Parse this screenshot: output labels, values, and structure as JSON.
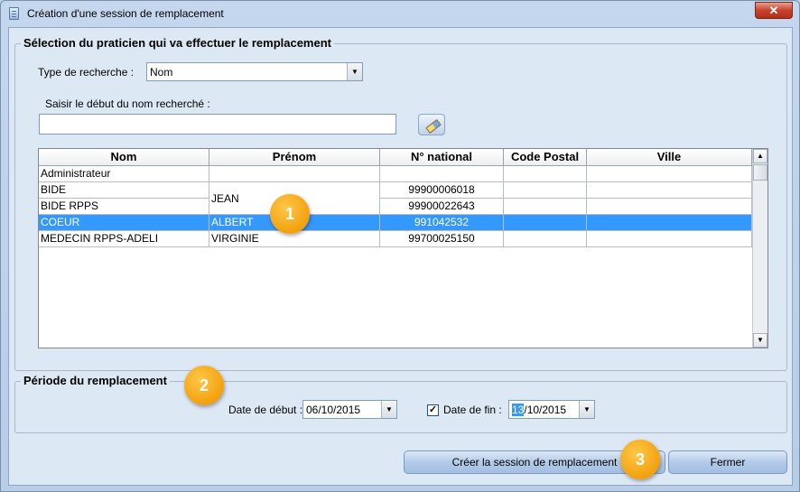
{
  "window": {
    "title": "Création d'une session de remplacement",
    "close_label": "✕"
  },
  "selection": {
    "group_title": "Sélection du praticien qui va effectuer le remplacement",
    "search_type_label": "Type de recherche :",
    "search_type_value": "Nom",
    "name_prompt": "Saisir le début du nom recherché :",
    "name_value": ""
  },
  "table": {
    "columns": [
      "Nom",
      "Prénom",
      "N° national",
      "Code Postal",
      "Ville"
    ],
    "rows": [
      {
        "nom": "Administrateur",
        "prenom": "",
        "numero": "",
        "cp": "",
        "ville": ""
      },
      {
        "nom": "BIDE",
        "prenom": "JEAN",
        "numero": "99900006018",
        "cp": "",
        "ville": ""
      },
      {
        "nom": "BIDE RPPS",
        "prenom": "",
        "numero": "99900022643",
        "cp": "",
        "ville": ""
      },
      {
        "nom": "COEUR",
        "prenom": "ALBERT",
        "numero": "991042532",
        "cp": "",
        "ville": ""
      },
      {
        "nom": "MEDECIN RPPS-ADELI",
        "prenom": "VIRGINIE",
        "numero": "99700025150",
        "cp": "",
        "ville": ""
      }
    ],
    "selected_index": 3
  },
  "periode": {
    "group_title": "Période du remplacement",
    "start_label": "Date de début :",
    "start_value": "06/10/2015",
    "end_checkbox_checked": true,
    "end_check_mark": "✓",
    "end_label": "Date de fin :",
    "end_value_day": "13",
    "end_value_rest": "/10/2015"
  },
  "buttons": {
    "create_label": "Créer la session de remplacement",
    "close_label": "Fermer"
  },
  "markers": {
    "one": "1",
    "two": "2",
    "three": "3"
  },
  "colors": {
    "selection": "#3399ff",
    "marker": "#f2a10c"
  },
  "icons": {
    "dropdown": "▼",
    "scroll_up": "▲",
    "scroll_down": "▼"
  }
}
